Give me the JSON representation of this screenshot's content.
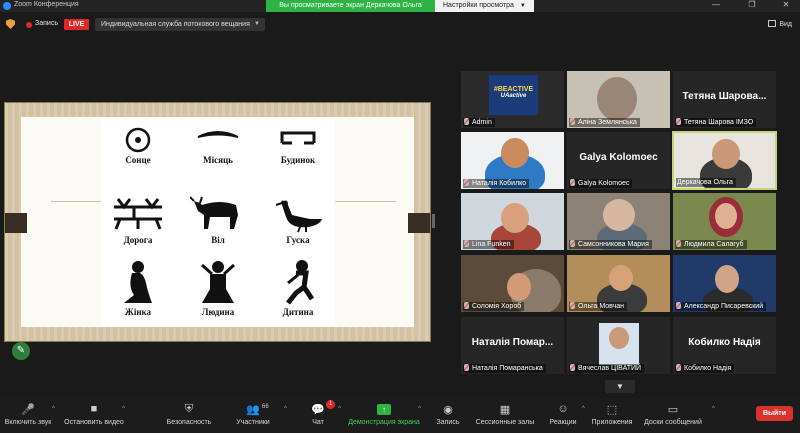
{
  "window": {
    "title": "Zoom Конференция",
    "controls": [
      "—",
      "❐",
      "✕"
    ]
  },
  "share_banner": {
    "viewing": "Вы просматриваете экран Деркачова Ольга",
    "view_settings": "Настройки просмотра"
  },
  "topbar": {
    "recording": "Запись",
    "live": "LIVE",
    "stream_service": "Индивидуальная служба потокового вещания",
    "view": "Вид"
  },
  "slide": {
    "symbols": [
      {
        "label": "Сонце"
      },
      {
        "label": "Місяць"
      },
      {
        "label": "Будинок"
      },
      {
        "label": "Дорога"
      },
      {
        "label": "Віл"
      },
      {
        "label": "Гуска"
      },
      {
        "label": "Жінка"
      },
      {
        "label": "Людина"
      },
      {
        "label": "Дитина"
      }
    ]
  },
  "participants": [
    {
      "name": "Admin",
      "badge_line1": "#BEACTIVE",
      "badge_line2": "UAactive"
    },
    {
      "name": "Аліна Землянська"
    },
    {
      "name": "Тетяна Шарова ІМЗО",
      "display": "Тетяна Шарова..."
    },
    {
      "name": "Наталія Кобилко"
    },
    {
      "name": "Galya Kolomoec",
      "display": "Galya Kolomoec"
    },
    {
      "name": "Деркачова Ольга"
    },
    {
      "name": "Lina Funken"
    },
    {
      "name": "Самсонникова Мария"
    },
    {
      "name": "Людмила Салагуб"
    },
    {
      "name": "Соломія Хороб"
    },
    {
      "name": "Ольга Мовчан"
    },
    {
      "name": "Александр Писаревский"
    },
    {
      "name": "Наталія Помаранська",
      "display": "Наталія Помар..."
    },
    {
      "name": "Вячеслав ЦІВАТИЙ"
    },
    {
      "name": "Кобилко Надія",
      "display": "Кобилко Надія"
    }
  ],
  "toolbar": {
    "mic": "Включить звук",
    "video": "Остановить видео",
    "security": "Безопасность",
    "participants": "Участники",
    "participants_count": "66",
    "chat": "Чат",
    "chat_count": "1",
    "share": "Демонстрация экрана",
    "record": "Запись",
    "breakout": "Сессионные залы",
    "reactions": "Реакции",
    "apps": "Приложения",
    "whiteboard": "Доски сообщений",
    "leave": "Выйти"
  },
  "colors": {
    "accent_green": "#2fb344",
    "live_red": "#e02828",
    "leave_red": "#d9322b",
    "active_speaker": "#c6d57a"
  }
}
